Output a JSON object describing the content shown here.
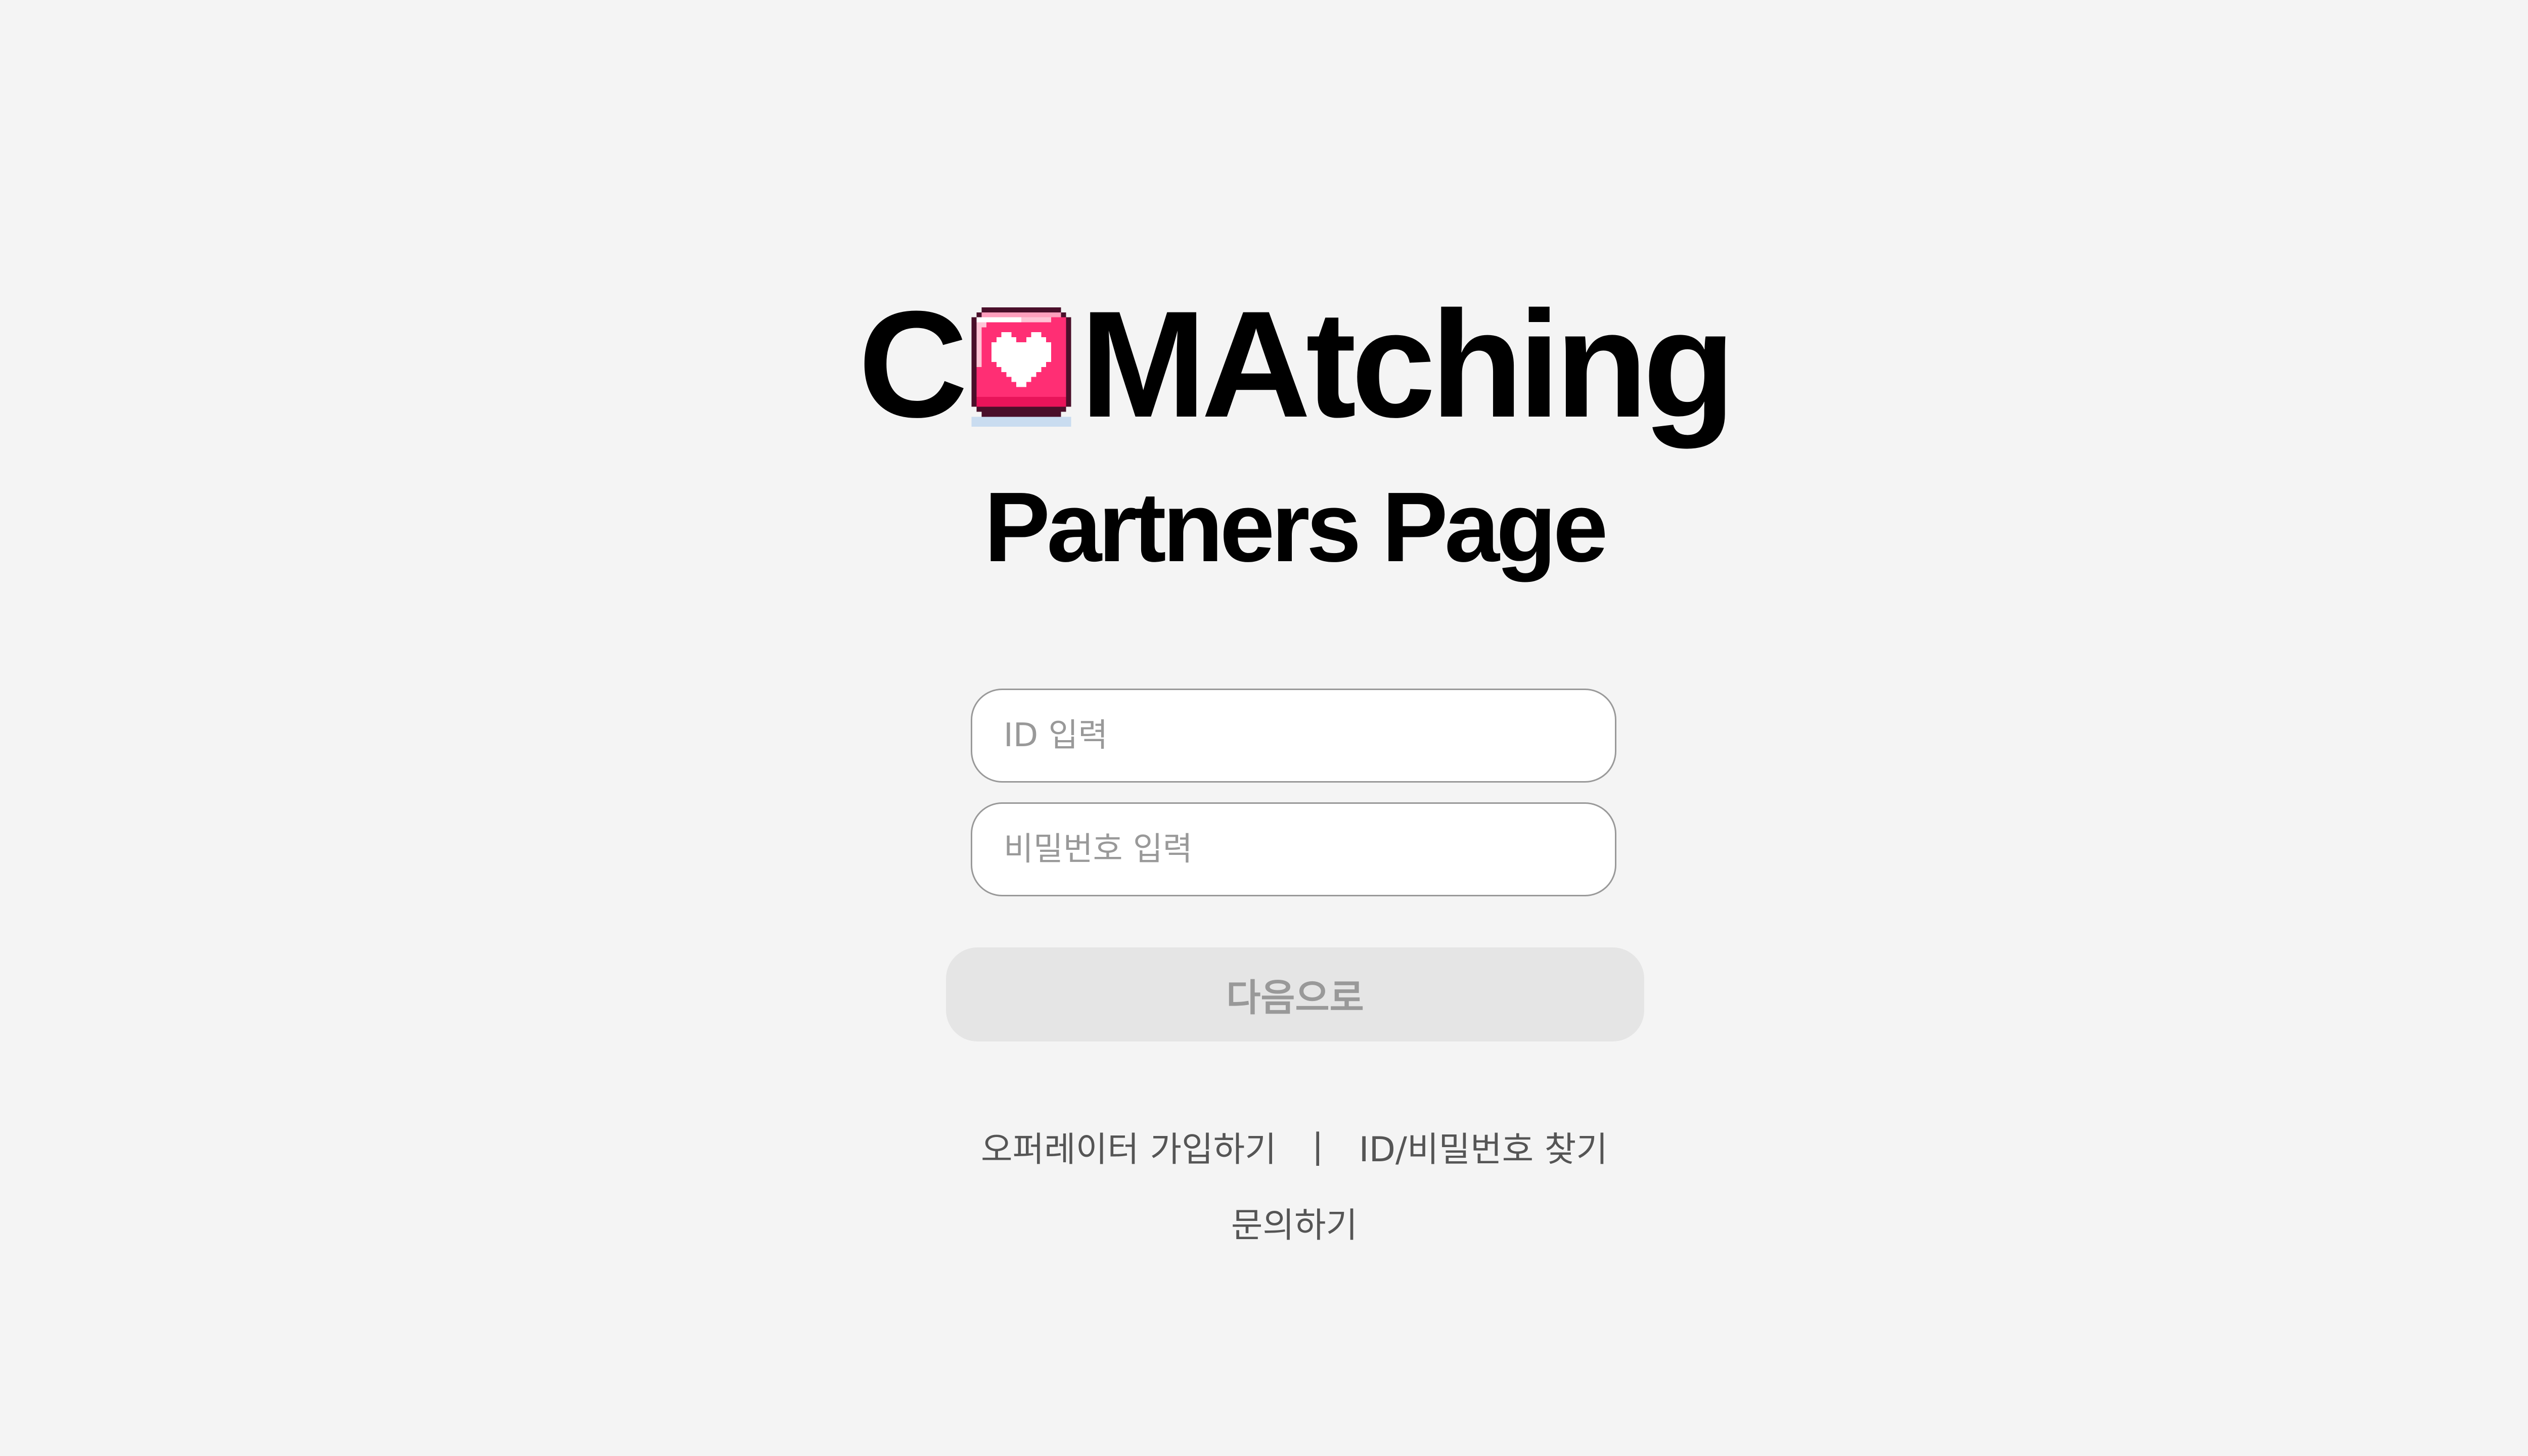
{
  "logo": {
    "prefix": "C",
    "suffix": "MAtching",
    "icon": "pixel-heart-icon",
    "colors": {
      "pink": "#ff2e74",
      "outline": "#4a0f2a",
      "shadow": "#c9dcf0"
    }
  },
  "subtitle": "Partners Page",
  "form": {
    "id_placeholder": "ID 입력",
    "password_placeholder": "비밀번호 입력",
    "submit_label": "다음으로"
  },
  "links": {
    "signup": "오퍼레이터 가입하기",
    "separator": "|",
    "find": "ID/비밀번호 찾기",
    "inquiry": "문의하기"
  }
}
